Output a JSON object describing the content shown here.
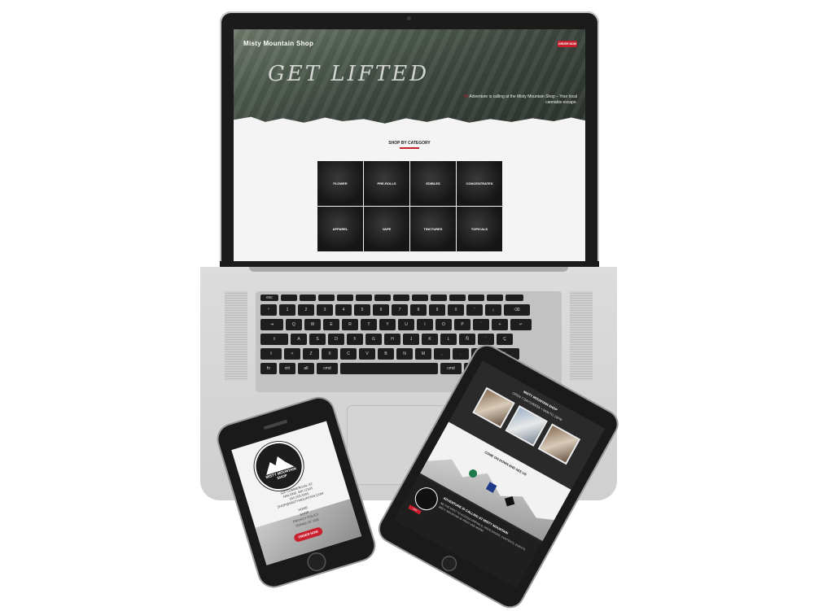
{
  "laptop": {
    "site_name": "Misty Mountain Shop",
    "order_button": "ORDER NOW",
    "hero_title": "GET LIFTED",
    "tagline_arrow": ">>",
    "tagline": "Adventure is calling at the Misty Mountain Shop – Your local cannabis escape.",
    "section_title": "SHOP BY CATEGORY",
    "categories": [
      "FLOWER",
      "PRE-ROLLS",
      "EDIBLES",
      "CONCENTRATES",
      "APPAREL",
      "VAPE",
      "TINCTURES",
      "TOPICALS"
    ],
    "accent_color": "#c8202f"
  },
  "keyboard": {
    "row1": [
      "esc",
      "",
      "",
      "",
      "",
      "",
      "",
      "",
      "",
      "",
      "",
      "",
      "",
      ""
    ],
    "row2": [
      "º",
      "1",
      "2",
      "3",
      "4",
      "5",
      "6",
      "7",
      "8",
      "9",
      "0",
      "'",
      "¡",
      "⌫"
    ],
    "row3": [
      "⇥",
      "Q",
      "W",
      "E",
      "R",
      "T",
      "Y",
      "U",
      "I",
      "O",
      "P",
      "`",
      "+",
      "↵"
    ],
    "row4": [
      "⇪",
      "A",
      "S",
      "D",
      "F",
      "G",
      "H",
      "J",
      "K",
      "L",
      "Ñ",
      "´",
      "Ç"
    ],
    "row5": [
      "⇧",
      "<",
      "Z",
      "X",
      "C",
      "V",
      "B",
      "N",
      "M",
      ",",
      ".",
      "-",
      "⇧"
    ],
    "row6": [
      "fn",
      "ctrl",
      "alt",
      "cmd",
      "",
      "cmd",
      "alt"
    ]
  },
  "phone": {
    "logo_text": "MISTY MOUNTAIN SHOP",
    "address_lines": [
      "325 COMMERCIAL ST.",
      "MALONE, WA 12345",
      "555.555.5555",
      "SHOP@MISTYMOUNTAIN.COM"
    ],
    "menu": [
      "HOME",
      "SHOP",
      "PRIVACY POLICY",
      "TERMS OF USE"
    ],
    "order_button": "ORDER NOW"
  },
  "tablet": {
    "title": "MISTY MOUNTAIN SHOP",
    "hours": "OPEN 7 DAYS/WEEK • 9AM TO 10PM",
    "map_title": "COME ON DOWN AND SEE US",
    "bottom_head": "ADVENTURE IS CALLING AT MISTY MOUNTAIN",
    "bottom_text": "BE THE FIRST TO ACCESS ARRIVALS, PRICE DROPS, CONTESTS, EVENTS, MISTY MOUNTAIN IN PRINT AND MORE!",
    "bottom_button": "JOIN"
  }
}
